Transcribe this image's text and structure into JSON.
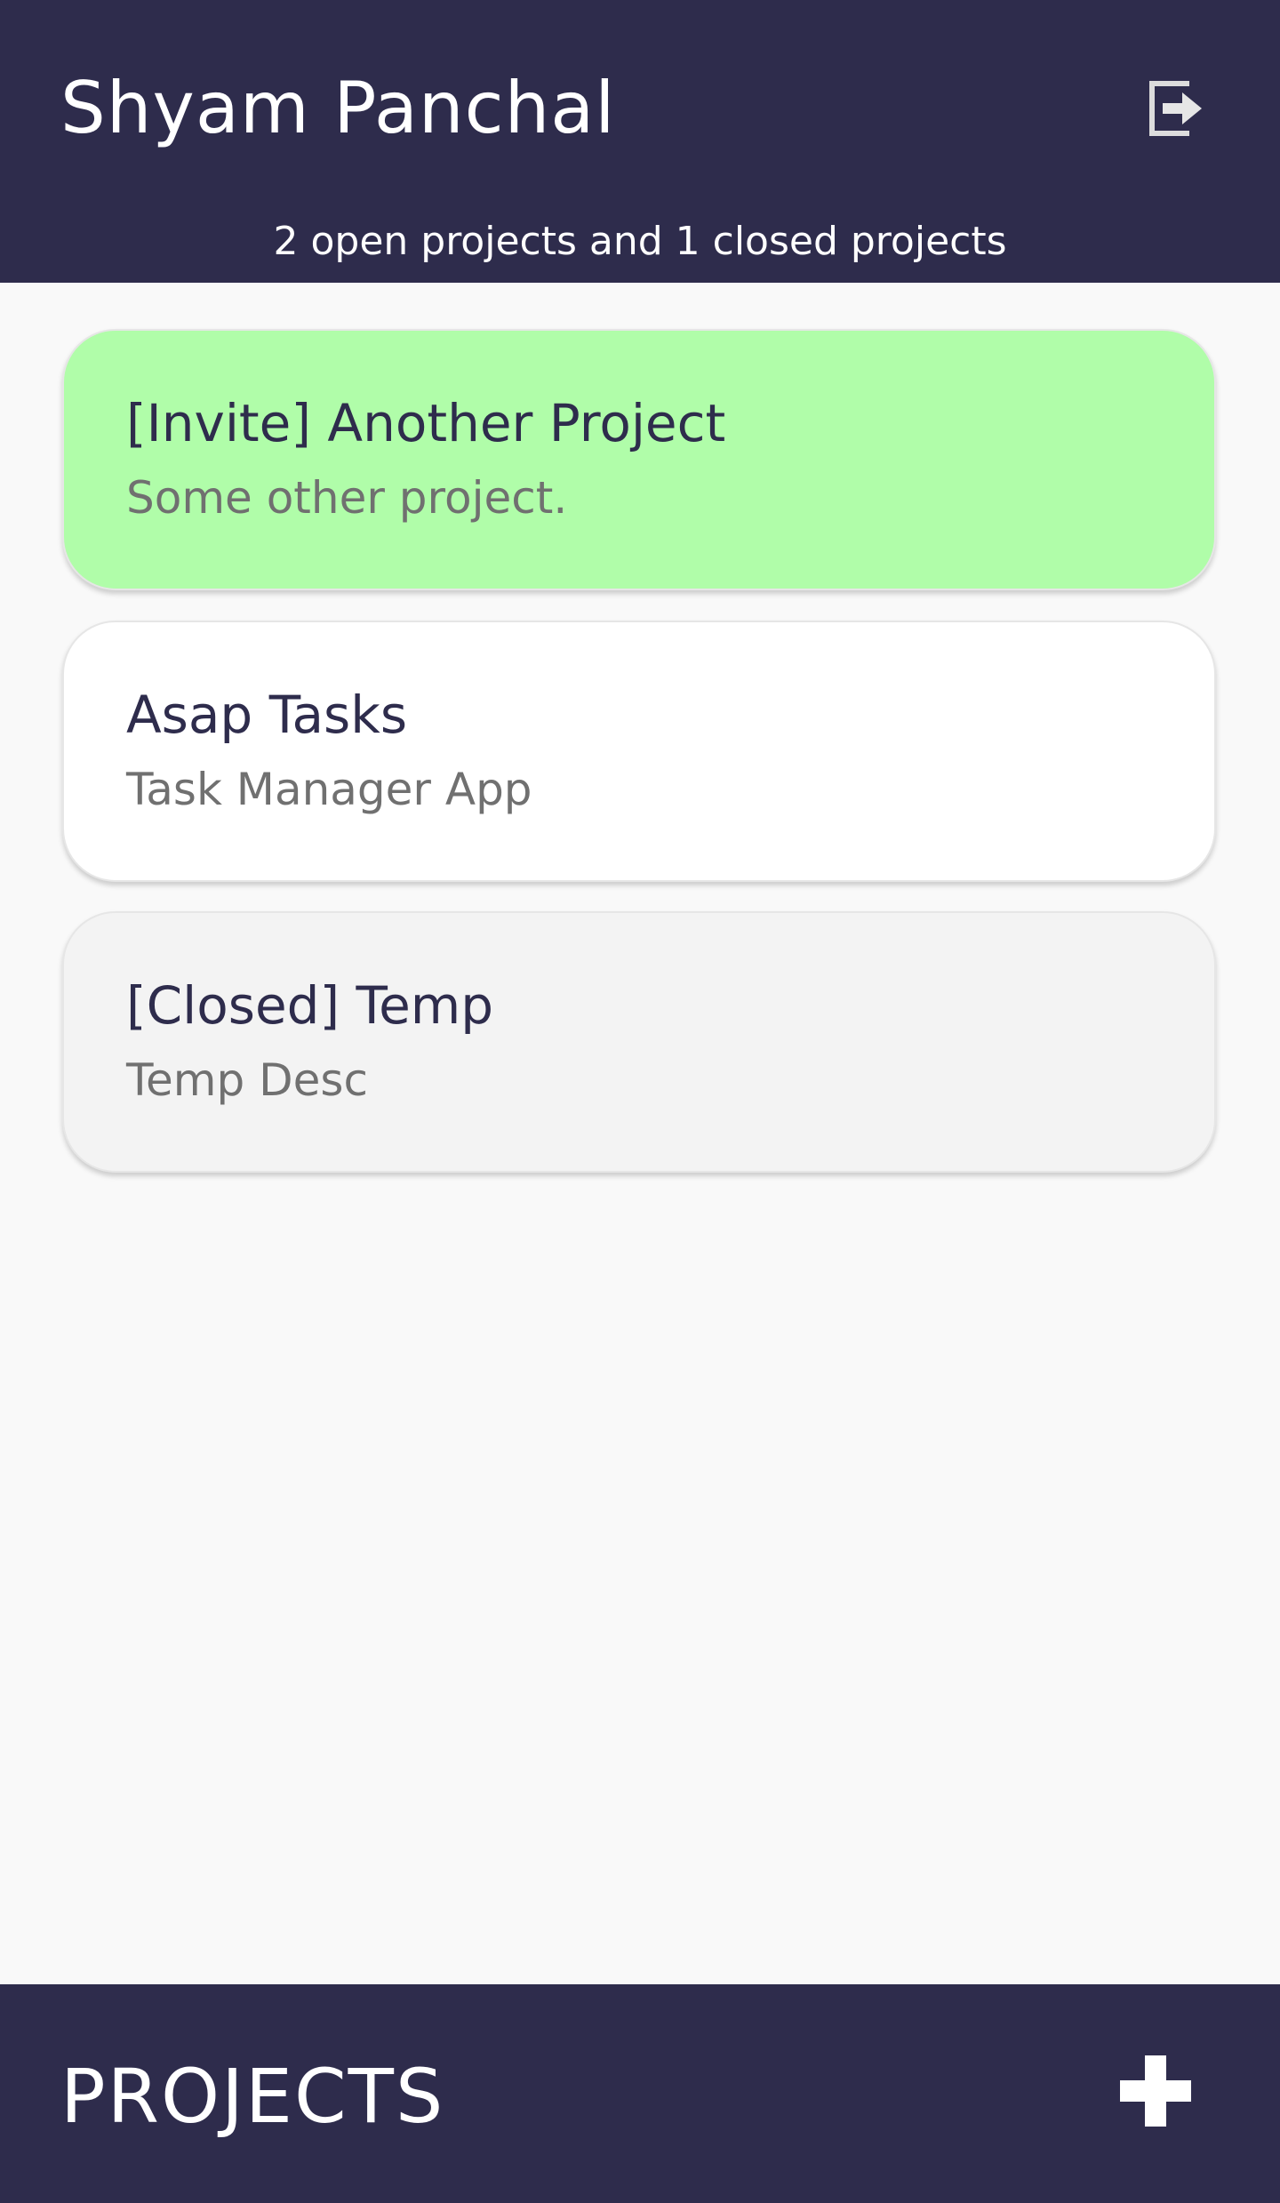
{
  "header": {
    "user_name": "Shyam Panchal",
    "summary": "2 open projects and 1 closed projects",
    "logout_icon": "logout-icon"
  },
  "projects": [
    {
      "title": "[Invite] Another Project",
      "description": "Some other project.",
      "status": "invite",
      "color": "#b0fda9"
    },
    {
      "title": "Asap Tasks",
      "description": "Task Manager App",
      "status": "open",
      "color": "#ffffff"
    },
    {
      "title": "[Closed] Temp",
      "description": "Temp Desc",
      "status": "closed",
      "color": "#f3f3f3"
    }
  ],
  "footer": {
    "label": "PROJECTS",
    "add_icon": "plus-icon"
  },
  "colors": {
    "header_bg": "#2e2c4c",
    "page_bg": "#f9f9f9",
    "title_text": "#2e2c4c",
    "desc_text": "#707070"
  }
}
